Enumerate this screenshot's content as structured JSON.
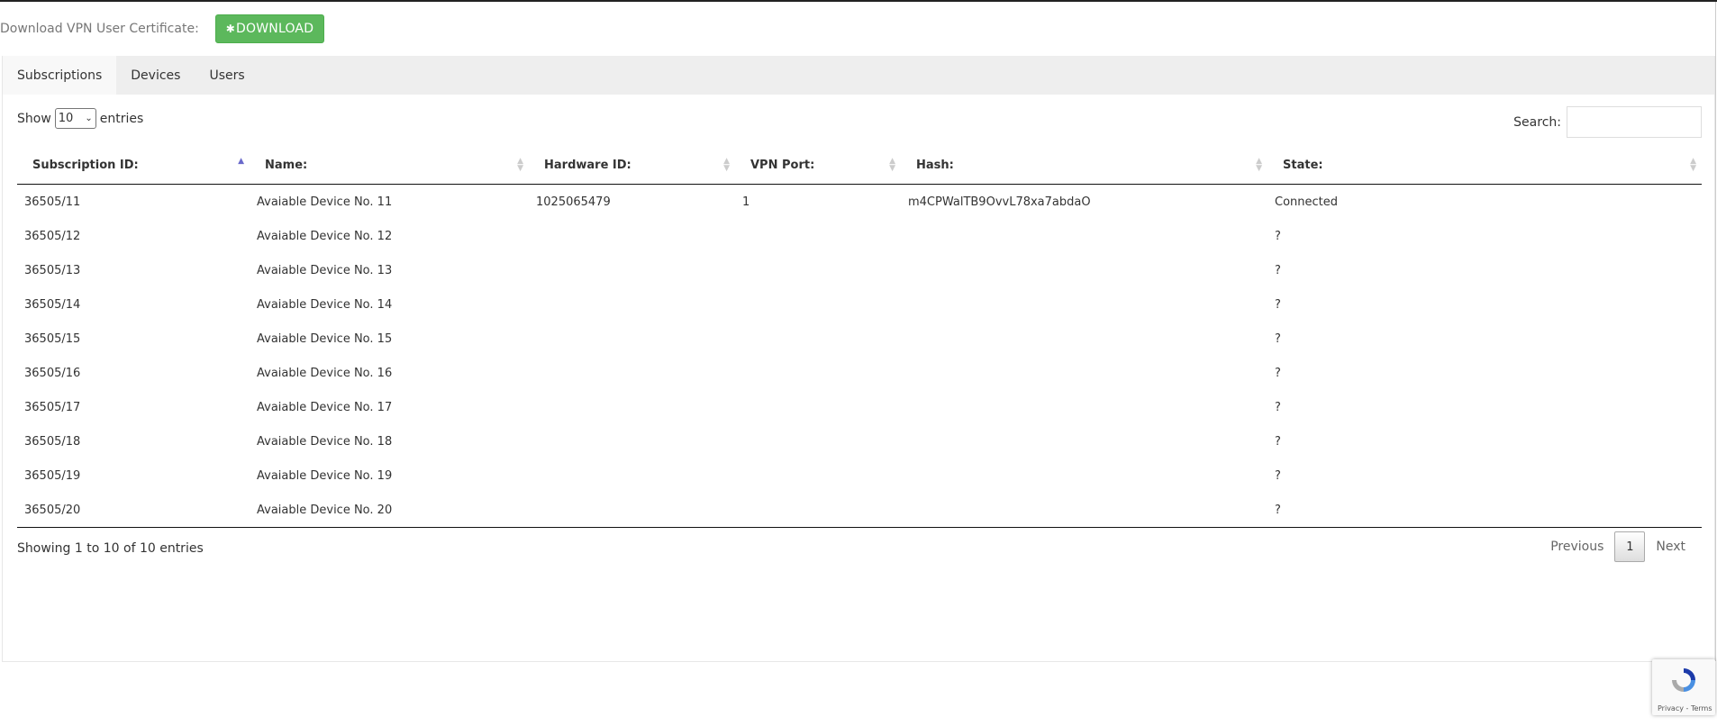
{
  "certificate": {
    "label": "Download VPN User Certificate:",
    "button_label": "DOWNLOAD",
    "button_color": "#5cb85c"
  },
  "tabs": [
    {
      "label": "Subscriptions",
      "active": true
    },
    {
      "label": "Devices",
      "active": false
    },
    {
      "label": "Users",
      "active": false
    }
  ],
  "controls": {
    "show_label": "Show",
    "entries_label": "entries",
    "page_length": "10",
    "search_label": "Search:",
    "search_value": ""
  },
  "table": {
    "headers": [
      "Subscription ID:",
      "Name:",
      "Hardware ID:",
      "VPN Port:",
      "Hash:",
      "State:"
    ],
    "sorted_column": "Subscription ID:",
    "rows": [
      [
        "36505/11",
        "Avaiable Device No. 11",
        "1025065479",
        "1",
        "m4CPWalTB9OvvL78xa7abdaO",
        "Connected"
      ],
      [
        "36505/12",
        "Avaiable Device No. 12",
        "",
        "",
        "",
        "?"
      ],
      [
        "36505/13",
        "Avaiable Device No. 13",
        "",
        "",
        "",
        "?"
      ],
      [
        "36505/14",
        "Avaiable Device No. 14",
        "",
        "",
        "",
        "?"
      ],
      [
        "36505/15",
        "Avaiable Device No. 15",
        "",
        "",
        "",
        "?"
      ],
      [
        "36505/16",
        "Avaiable Device No. 16",
        "",
        "",
        "",
        "?"
      ],
      [
        "36505/17",
        "Avaiable Device No. 17",
        "",
        "",
        "",
        "?"
      ],
      [
        "36505/18",
        "Avaiable Device No. 18",
        "",
        "",
        "",
        "?"
      ],
      [
        "36505/19",
        "Avaiable Device No. 19",
        "",
        "",
        "",
        "?"
      ],
      [
        "36505/20",
        "Avaiable Device No. 20",
        "",
        "",
        "",
        "?"
      ]
    ]
  },
  "footer": {
    "info": "Showing 1 to 10 of 10 entries",
    "previous": "Previous",
    "current_page": "1",
    "next": "Next"
  },
  "recaptcha": {
    "terms": "Privacy - Terms"
  }
}
